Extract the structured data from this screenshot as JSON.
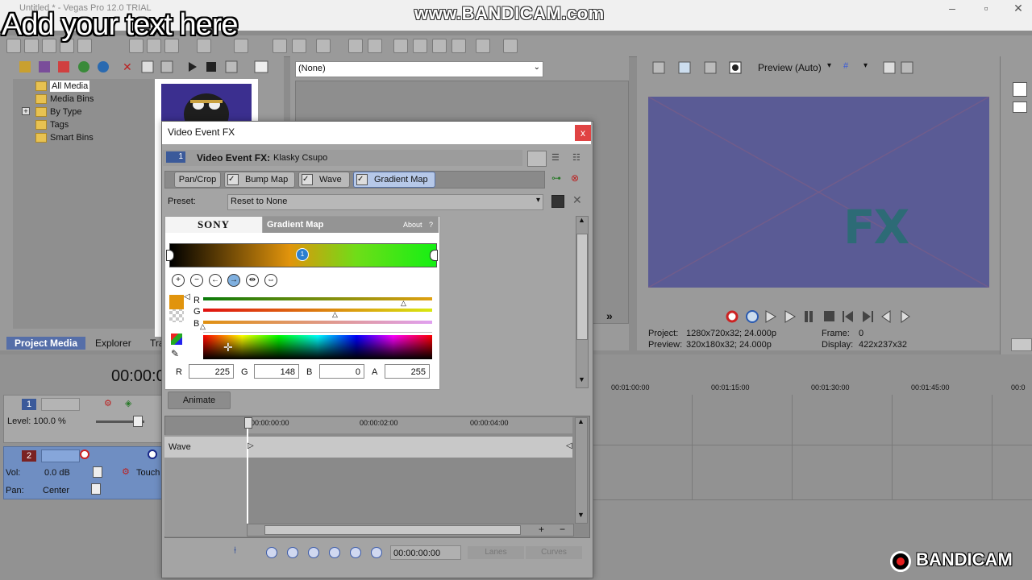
{
  "overlay": {
    "caption": "Add your text here",
    "bandicam_url": "www.BANDICAM.com",
    "bandicam_logo": "BANDICAM"
  },
  "window": {
    "title": "Untitled * - Vegas Pro 12.0 TRIAL"
  },
  "media_panel": {
    "tree": [
      "All Media",
      "Media Bins",
      "By Type",
      "Tags",
      "Smart Bins"
    ],
    "tabs": [
      "Project Media",
      "Explorer",
      "Tra"
    ]
  },
  "trimmer": {
    "selector_value": "(None)"
  },
  "preview": {
    "mode_label": "Preview (Auto)",
    "project_label": "Project:",
    "project_value": "1280x720x32; 24.000p",
    "preview_label": "Preview:",
    "preview_value": "320x180x32; 24.000p",
    "frame_label": "Frame:",
    "frame_value": "0",
    "display_label": "Display:",
    "display_value": "422x237x32",
    "overlay_text": "FX"
  },
  "timeline": {
    "timecode": "00:00:0",
    "ruler": [
      "00:01:00:00",
      "00:01:15:00",
      "00:01:30:00",
      "00:01:45:00",
      "00:0"
    ],
    "track1": {
      "number": "1",
      "level_label": "Level: 100.0 %"
    },
    "track2": {
      "number": "2",
      "vol_label": "Vol:",
      "vol_value": "0.0 dB",
      "pan_label": "Pan:",
      "pan_value": "Center",
      "touch_label": "Touch"
    }
  },
  "dialog": {
    "title": "Video Event FX",
    "close_label": "x",
    "fx_label": "Video Event FX:",
    "fx_value": "Klasky Csupo",
    "track_number": "1",
    "chain": [
      {
        "label": "Pan/Crop",
        "checked": false
      },
      {
        "label": "Bump Map",
        "checked": true
      },
      {
        "label": "Wave",
        "checked": true
      },
      {
        "label": "Gradient Map",
        "checked": true,
        "active": true
      }
    ],
    "preset_label": "Preset:",
    "preset_value": "Reset to None",
    "plugin": {
      "brand": "SONY",
      "name": "Gradient Map",
      "about": "About",
      "help": "?",
      "marker_label": "1",
      "channel_labels": [
        "R",
        "G",
        "B"
      ],
      "fields": [
        {
          "label": "R",
          "value": "225"
        },
        {
          "label": "G",
          "value": "148"
        },
        {
          "label": "B",
          "value": "0"
        },
        {
          "label": "A",
          "value": "255"
        }
      ]
    },
    "animate_label": "Animate",
    "keyframes": {
      "ruler": [
        "00:00:00:00",
        "00:00:02:00",
        "00:00:04:00"
      ],
      "track_label": "Wave",
      "time_value": "00:00:00:00",
      "lanes_label": "Lanes",
      "curves_label": "Curves"
    }
  },
  "colors": {
    "accent_blue": "#556ea8",
    "track2_blue": "#6f8ec2",
    "preview_bg": "#5a5c96",
    "gradient_stop": "#e1940c",
    "close_red": "#e04343"
  }
}
